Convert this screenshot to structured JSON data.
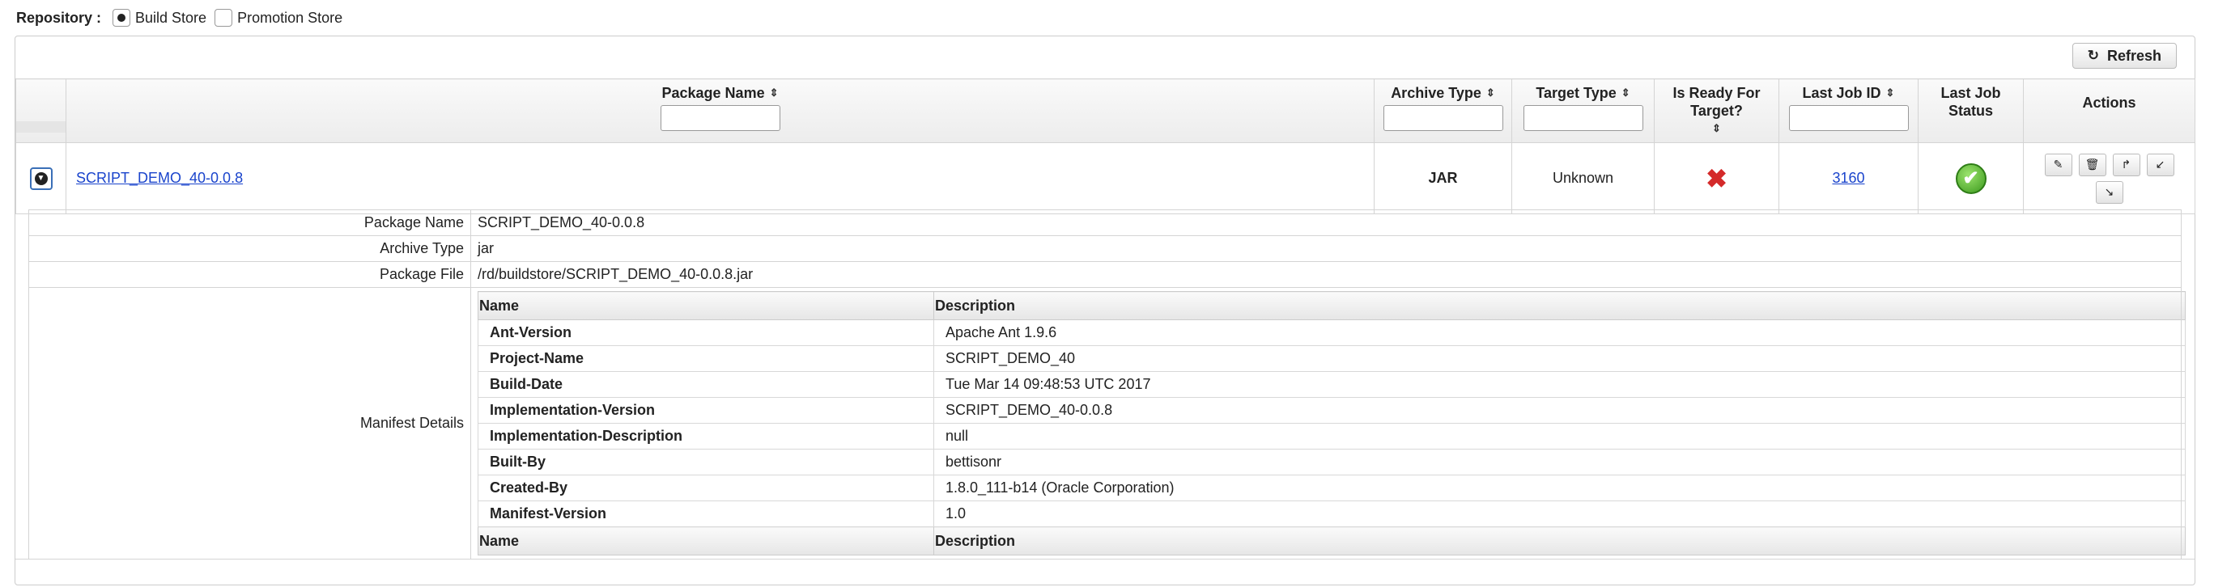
{
  "repository": {
    "label": "Repository :",
    "options": [
      {
        "label": "Build Store",
        "selected": true
      },
      {
        "label": "Promotion Store",
        "selected": false
      }
    ]
  },
  "toolbar": {
    "refresh_label": "Refresh",
    "refresh_icon": "refresh-icon"
  },
  "columns": {
    "package_name": "Package Name",
    "archive_type": "Archive Type",
    "target_type": "Target Type",
    "is_ready": "Is Ready For Target?",
    "last_job_id": "Last Job ID",
    "last_job_status": "Last Job Status",
    "actions": "Actions"
  },
  "row": {
    "package_name": "SCRIPT_DEMO_40-0.0.8",
    "archive_type": "JAR",
    "target_type": "Unknown",
    "is_ready": "not-ready-icon",
    "last_job_id": "3160",
    "last_job_status": "success-icon",
    "actions": [
      "edit-icon",
      "delete-icon",
      "promote-icon",
      "deploy-icon",
      "download-icon"
    ]
  },
  "details": {
    "package_name_label": "Package Name",
    "package_name_value": "SCRIPT_DEMO_40-0.0.8",
    "archive_type_label": "Archive Type",
    "archive_type_value": "jar",
    "package_file_label": "Package File",
    "package_file_value": "/rd/buildstore/SCRIPT_DEMO_40-0.0.8.jar",
    "manifest_label": "Manifest Details"
  },
  "manifest": {
    "header_name": "Name",
    "header_description": "Description",
    "rows": [
      {
        "name": "Ant-Version",
        "value": "Apache Ant 1.9.6"
      },
      {
        "name": "Project-Name",
        "value": "SCRIPT_DEMO_40"
      },
      {
        "name": "Build-Date",
        "value": "Tue Mar 14 09:48:53 UTC 2017"
      },
      {
        "name": "Implementation-Version",
        "value": "SCRIPT_DEMO_40-0.0.8"
      },
      {
        "name": "Implementation-Description",
        "value": "null"
      },
      {
        "name": "Built-By",
        "value": "bettisonr"
      },
      {
        "name": "Created-By",
        "value": "1.8.0_111-b14 (Oracle Corporation)"
      },
      {
        "name": "Manifest-Version",
        "value": "1.0"
      }
    ]
  }
}
